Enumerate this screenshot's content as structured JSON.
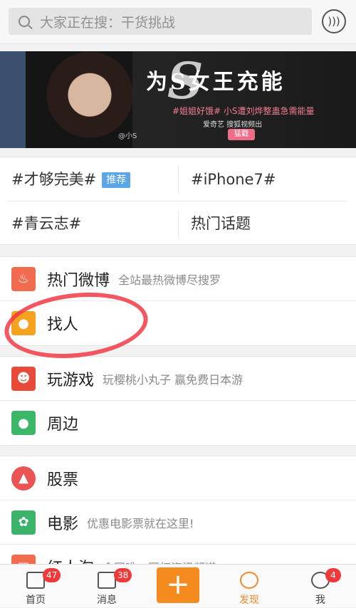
{
  "search": {
    "placeholder": "大家正在搜：干货挑战",
    "voice_icon": "voice-icon"
  },
  "banner": {
    "headline": "为S女王充能",
    "big_letter": "S",
    "subtitle": "#姐姐好饿# 小S遭刘烨整蛊急需能量",
    "logos": "爱奇艺 搜狐视频出",
    "cta": "猛戳",
    "handle": "@小S",
    "dots": 4,
    "active_dot": 1
  },
  "topics": {
    "items": [
      {
        "label": "#才够完美#",
        "tag": "推荐"
      },
      {
        "label": "#iPhone7#"
      },
      {
        "label": "#青云志#"
      },
      {
        "label": "热门话题"
      }
    ]
  },
  "sections": [
    {
      "rows": [
        {
          "title": "热门微博",
          "sub": "全站最热微博尽搜罗",
          "icon": "fire-icon",
          "color": "#f26b4f"
        },
        {
          "title": "找人",
          "sub": "",
          "icon": "person-search-icon",
          "color": "#f5a31f"
        }
      ]
    },
    {
      "rows": [
        {
          "title": "玩游戏",
          "sub": "玩樱桃小丸子 赢免费日本游",
          "icon": "game-icon",
          "color": "#e84a3a"
        },
        {
          "title": "周边",
          "sub": "",
          "icon": "location-icon",
          "color": "#3cb76a"
        }
      ]
    },
    {
      "rows": [
        {
          "title": "股票",
          "sub": "",
          "icon": "stock-icon",
          "color": "#ea5452"
        },
        {
          "title": "电影",
          "sub": "优惠电影票就在这里!",
          "icon": "film-icon",
          "color": "#3bb36b"
        },
        {
          "title": "红人淘",
          "sub": "全网唯一网红资讯频道",
          "icon": "bag-icon",
          "color": "#f26b4f"
        }
      ]
    }
  ],
  "tabbar": {
    "tabs": [
      {
        "label": "首页",
        "badge": "47",
        "icon": "home-icon"
      },
      {
        "label": "消息",
        "badge": "38",
        "icon": "mail-icon"
      },
      {
        "label": "发现",
        "badge": "",
        "icon": "discover-icon"
      },
      {
        "label": "我",
        "badge": "4",
        "icon": "profile-icon"
      }
    ],
    "compose": "+"
  },
  "colors": {
    "accent": "#f58a1f",
    "badge": "#f03a3a",
    "tag": "#5aa6e6"
  }
}
